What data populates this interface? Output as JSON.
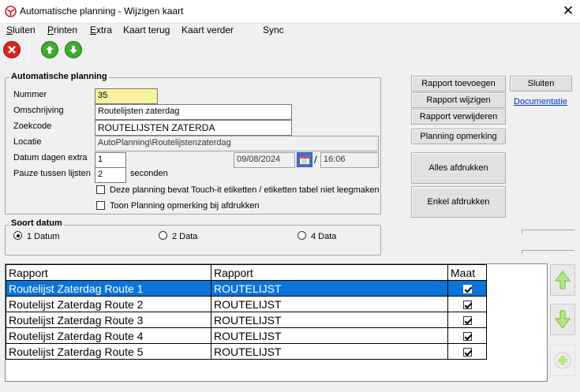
{
  "window": {
    "title": "Automatische planning - Wijzigen kaart",
    "close_glyph": "✕"
  },
  "menu": {
    "items": [
      {
        "label": "Sluiten",
        "underline": "S",
        "rest": "luiten"
      },
      {
        "label": "Printen",
        "underline": "P",
        "rest": "rinten"
      },
      {
        "label": "Extra",
        "underline": "E",
        "rest": "xtra"
      },
      {
        "label": "Kaart terug"
      },
      {
        "label": "Kaart verder"
      },
      {
        "label": "Sync"
      }
    ]
  },
  "toolbar": {
    "icons": [
      "close-red-icon",
      "arrow-up-green-icon",
      "arrow-down-green-icon"
    ]
  },
  "form": {
    "group_title": "Automatische planning",
    "nummer_label": "Nummer",
    "nummer_value": "35",
    "omschrijving_label": "Omschrijving",
    "omschrijving_value": "Routelijsten zaterdag",
    "zoekcode_label": "Zoekcode",
    "zoekcode_value": "ROUTELIJSTEN ZATERDA",
    "locatie_label": "Locatie",
    "locatie_value": "AutoPlanning\\Routelijstenzaterdag",
    "datum_label": "Datum dagen extra",
    "datum_value": "1",
    "date_value": "09/08/2024",
    "date_sep": "/",
    "time_value": "16:06",
    "pauze_label": "Pauze tussen lijsten",
    "pauze_value": "2",
    "seconden_label": "seconden",
    "check1_label": "Deze planning bevat Touch-it etiketten / etiketten tabel niet leegmaken",
    "check2_label": "Toon Planning opmerking bij afdrukken"
  },
  "soort_datum": {
    "title": "Soort datum",
    "options": [
      "1 Datum",
      "2 Data",
      "4 Data"
    ],
    "selected": "1 Datum"
  },
  "buttons": {
    "rapport_toevoegen": "Rapport toevoegen",
    "rapport_wijzigen": "Rapport wijzigen",
    "rapport_verwijderen": "Rapport verwijderen",
    "planning_opmerking": "Planning opmerking",
    "alles_afdrukken": "Alles afdrukken",
    "enkel_afdrukken": "Enkel afdrukken",
    "sluiten": "Sluiten",
    "documentatie": "Documentatie"
  },
  "table": {
    "headers": [
      "Rapport",
      "Rapport",
      "Maat"
    ],
    "rows": [
      {
        "col1": "Routelijst Zaterdag Route 1",
        "col2": "ROUTELIJST",
        "maat": true
      },
      {
        "col1": "Routelijst Zaterdag Route 2",
        "col2": "ROUTELIJST",
        "maat": true
      },
      {
        "col1": "Routelijst Zaterdag Route 3",
        "col2": "ROUTELIJST",
        "maat": true
      },
      {
        "col1": "Routelijst Zaterdag Route 4",
        "col2": "ROUTELIJST",
        "maat": true
      },
      {
        "col1": "Routelijst Zaterdag Route 5",
        "col2": "ROUTELIJST",
        "maat": true
      }
    ],
    "selected_row": 0
  },
  "colors": {
    "selection": "#0a74d8",
    "highlight_field": "#f7f1a0",
    "link": "#0033cc"
  }
}
